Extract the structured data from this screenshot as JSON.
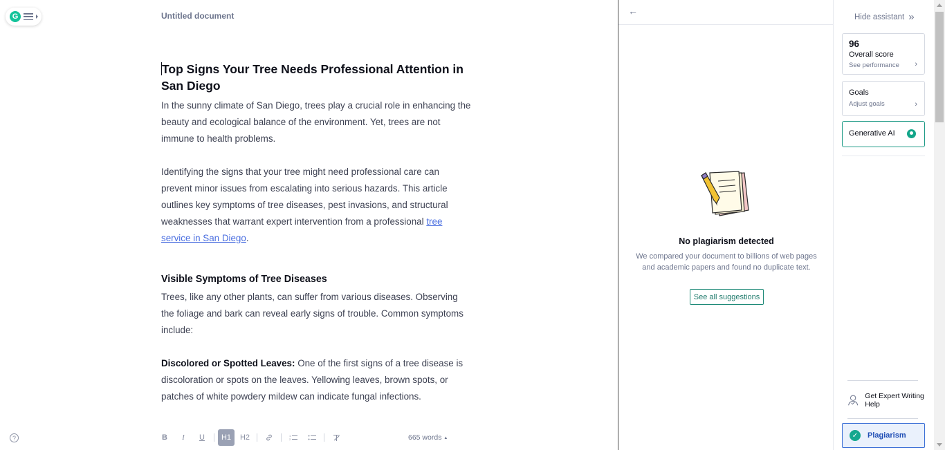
{
  "app": {
    "logo_letter": "G"
  },
  "document": {
    "title": "Untitled document",
    "heading": "Top Signs Your Tree Needs Professional Attention in San Diego",
    "intro": "In the sunny climate of San Diego, trees play a crucial role in enhancing the beauty and ecological balance of the environment. Yet, trees are not immune to health problems.",
    "para2_text": "Identifying the signs that your tree might need professional care can prevent minor issues from escalating into serious hazards. This article outlines key symptoms of tree diseases, pest invasions, and structural weaknesses that warrant expert intervention from a professional ",
    "para2_link": "tree service in San Diego",
    "para2_end": ".",
    "subheading": "Visible Symptoms of Tree Diseases",
    "para3": "Trees, like any other plants, can suffer from various diseases. Observing the foliage and bark can reveal early signs of trouble. Common symptoms include:",
    "para4_bold": "Discolored or Spotted Leaves:",
    "para4_text": " One of the first signs of a tree disease is discoloration or spots on the leaves. Yellowing leaves, brown spots, or patches of white powdery mildew can indicate fungal infections."
  },
  "toolbar": {
    "bold": "B",
    "italic": "I",
    "underline": "U",
    "h1": "H1",
    "h2": "H2",
    "link_icon": "link-icon",
    "ol_icon": "ordered-list-icon",
    "ul_icon": "unordered-list-icon",
    "clear_icon": "clear-format-icon",
    "word_count": "665 words",
    "word_count_caret": "▲",
    "help": "?"
  },
  "plagiarism_panel": {
    "back": "←",
    "title": "No plagiarism detected",
    "description": "We compared your document to billions of web pages and academic papers and found no duplicate text.",
    "button": "See all suggestions"
  },
  "assistant": {
    "hide_label": "Hide assistant",
    "hide_icon": "»",
    "score": "96",
    "score_label": "Overall score",
    "score_link": "See performance",
    "goals_label": "Goals",
    "goals_link": "Adjust goals",
    "genai_label": "Generative AI",
    "expert_label": "Get Expert Writing Help",
    "plagiarism_label": "Plagiarism",
    "chevron": "›"
  },
  "colors": {
    "accent_green": "#15c39a",
    "plagiarism_blue": "#3b6fd6",
    "link_blue": "#4a6ee0"
  }
}
